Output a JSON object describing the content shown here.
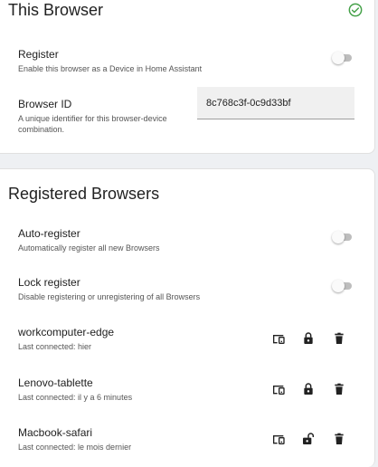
{
  "this_browser": {
    "title": "This Browser",
    "register": {
      "label": "Register",
      "description": "Enable this browser as a Device in Home Assistant",
      "enabled": false
    },
    "browser_id": {
      "label": "Browser ID",
      "description": "A unique identifier for this browser-device combination.",
      "value": "8c768c3f-0c9d33bf"
    }
  },
  "registered": {
    "title": "Registered Browsers",
    "auto_register": {
      "label": "Auto-register",
      "description": "Automatically register all new Browsers",
      "enabled": false
    },
    "lock_register": {
      "label": "Lock register",
      "description": "Disable registering or unregistering of all Browsers",
      "enabled": false
    },
    "browsers": [
      {
        "name": "workcomputer-edge",
        "last_connected": "Last connected: hier",
        "locked": true
      },
      {
        "name": "Lenovo-tablette",
        "last_connected": "Last connected: il y a 6 minutes",
        "locked": true
      },
      {
        "name": "Macbook-safari",
        "last_connected": "Last connected: le mois dernier",
        "locked": false
      }
    ]
  },
  "colors": {
    "success": "#43a047",
    "toggle_off": "#bdbdbd",
    "icon": "#212121"
  }
}
